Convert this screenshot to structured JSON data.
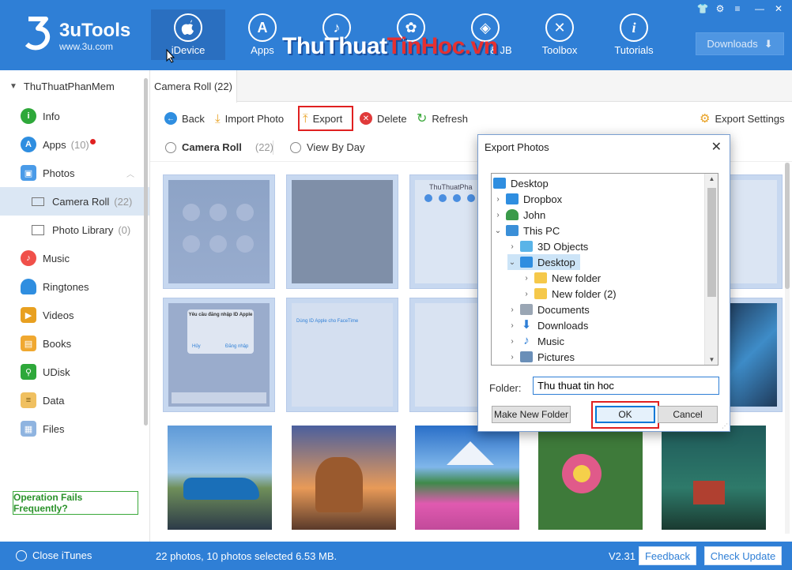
{
  "app": {
    "brand": "3uTools",
    "url": "www.3u.com",
    "watermark_part1": "ThuThuat",
    "watermark_part2": "TinHoc",
    "watermark_part3": ".vn"
  },
  "nav": [
    {
      "label": "iDevice",
      "icon": "apple-icon",
      "glyph": ""
    },
    {
      "label": "Apps",
      "icon": "app-store-icon",
      "glyph": "A"
    },
    {
      "label": "Ringtones",
      "icon": "bell-icon",
      "glyph": "♪"
    },
    {
      "label": "Wallpapers",
      "icon": "flower-icon",
      "glyph": "✿"
    },
    {
      "label": "Flash & JB",
      "icon": "dropbox-icon",
      "glyph": "◈"
    },
    {
      "label": "Toolbox",
      "icon": "toolbox-icon",
      "glyph": "✕"
    },
    {
      "label": "Tutorials",
      "icon": "info-icon",
      "glyph": "i"
    }
  ],
  "nav_visible_labels": [
    "iDevice",
    "Apps",
    "",
    "",
    "& JB",
    "Toolbox",
    "Tutorials"
  ],
  "downloads_label": "Downloads",
  "sidebar": {
    "device_name": "ThuThuatPhanMem",
    "items": [
      {
        "label": "Info",
        "count": "",
        "color": "#2ea83a",
        "glyph": "i"
      },
      {
        "label": "Apps",
        "count": "(10)",
        "color": "#2f8ee0",
        "glyph": "A"
      },
      {
        "label": "Photos",
        "count": "",
        "color": "#4a9be8",
        "glyph": "▣"
      },
      {
        "label": "Camera Roll",
        "count": "(22)",
        "color": "",
        "glyph": ""
      },
      {
        "label": "Photo Library",
        "count": "(0)",
        "color": "",
        "glyph": ""
      },
      {
        "label": "Music",
        "count": "",
        "color": "#f0504a",
        "glyph": "♪"
      },
      {
        "label": "Ringtones",
        "count": "",
        "color": "#2f8ee0",
        "glyph": "🔔"
      },
      {
        "label": "Videos",
        "count": "",
        "color": "#e8a020",
        "glyph": "▶"
      },
      {
        "label": "Books",
        "count": "",
        "color": "#f0a830",
        "glyph": "▤"
      },
      {
        "label": "UDisk",
        "count": "",
        "color": "#2ea83a",
        "glyph": "⚲"
      },
      {
        "label": "Data",
        "count": "",
        "color": "#f0c060",
        "glyph": "≡"
      },
      {
        "label": "Files",
        "count": "",
        "color": "#8fb4e0",
        "glyph": "▦"
      }
    ],
    "operation_fails": "Operation Fails Frequently?"
  },
  "main": {
    "tab_label": "Camera Roll (22)",
    "toolbar": {
      "back": "Back",
      "import_photo": "Import Photo",
      "export": "Export",
      "delete": "Delete",
      "refresh": "Refresh",
      "export_settings": "Export Settings"
    },
    "filter": {
      "camera_roll": "Camera Roll",
      "camera_roll_count": "(22)",
      "view_by_day": "View By Day"
    }
  },
  "status": {
    "close_itunes": "Close iTunes",
    "summary": "22 photos, 10 photos selected 6.53 MB.",
    "version": "V2.31",
    "feedback": "Feedback",
    "check_update": "Check Update"
  },
  "dialog": {
    "title": "Export Photos",
    "tree": [
      {
        "label": "Desktop",
        "depth": 0,
        "chev": "",
        "icon": "desktop-icon",
        "color": "#2f8ee0"
      },
      {
        "label": "Dropbox",
        "depth": 1,
        "chev": "›",
        "icon": "dropbox-icon",
        "color": "#2f8ee0"
      },
      {
        "label": "John",
        "depth": 1,
        "chev": "›",
        "icon": "user-icon",
        "color": "#3a9a4a"
      },
      {
        "label": "This PC",
        "depth": 1,
        "chev": "⌄",
        "icon": "pc-icon",
        "color": "#3a8fd8"
      },
      {
        "label": "3D Objects",
        "depth": 2,
        "chev": "›",
        "icon": "cube-icon",
        "color": "#5ab4e8"
      },
      {
        "label": "Desktop",
        "depth": 2,
        "chev": "⌄",
        "icon": "desktop-icon",
        "color": "#2f8ee0"
      },
      {
        "label": "New folder",
        "depth": 3,
        "chev": "›",
        "icon": "folder-icon",
        "color": "#f5c84a"
      },
      {
        "label": "New folder (2)",
        "depth": 3,
        "chev": "›",
        "icon": "folder-icon",
        "color": "#f5c84a"
      },
      {
        "label": "Documents",
        "depth": 2,
        "chev": "›",
        "icon": "documents-icon",
        "color": "#9aa6b4"
      },
      {
        "label": "Downloads",
        "depth": 2,
        "chev": "›",
        "icon": "download-arrow-icon",
        "color": "#2f7fd6"
      },
      {
        "label": "Music",
        "depth": 2,
        "chev": "›",
        "icon": "music-note-icon",
        "color": "#2f7fd6"
      },
      {
        "label": "Pictures",
        "depth": 2,
        "chev": "›",
        "icon": "pictures-icon",
        "color": "#6a8fb8"
      }
    ],
    "selected_index": 5,
    "folder_label": "Folder:",
    "folder_value": "Thu thuat tin hoc",
    "make_new_folder": "Make New Folder",
    "ok": "OK",
    "cancel": "Cancel"
  },
  "thumbnails": {
    "row1_text": [
      "ThuThuatPha"
    ],
    "keypad_title": "Yêu cầu đăng nhập ID Apple",
    "keypad_cancel": "Hủy",
    "keypad_login": "Đăng nhập",
    "facetime_link": "Dùng ID Apple cho FaceTime"
  },
  "colors": {
    "brand_blue": "#2f7fd6",
    "highlight_red": "#e02020",
    "selection_blue": "#c7d8f0"
  }
}
